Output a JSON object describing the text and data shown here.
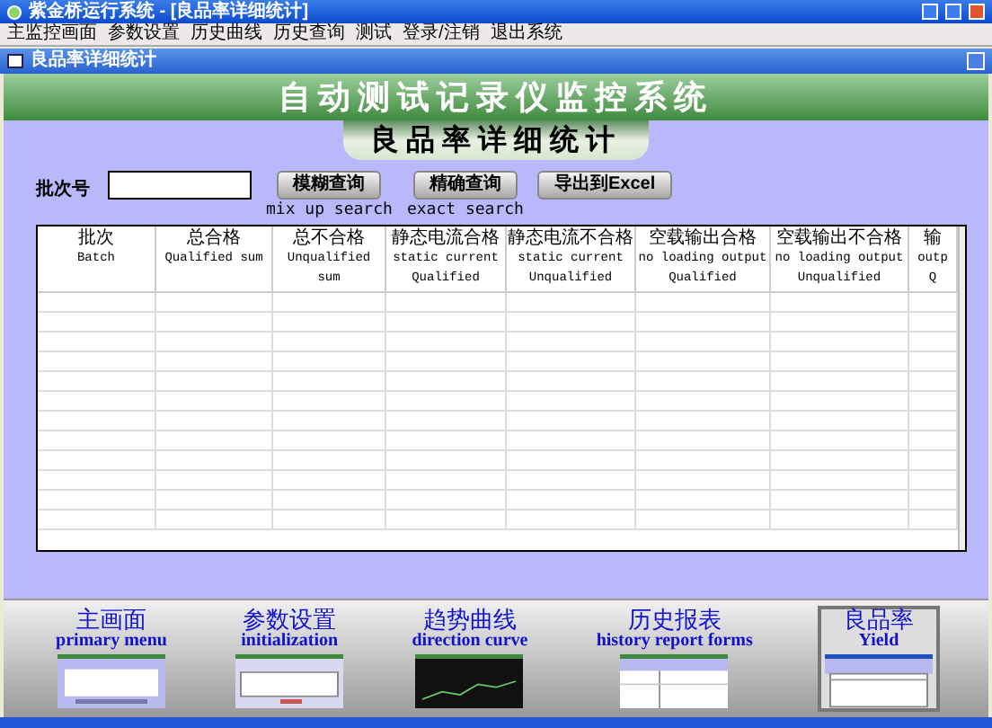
{
  "window": {
    "title": "紫金桥运行系统 - [良品率详细统计]"
  },
  "menu": [
    "主监控画面",
    "参数设置",
    "历史曲线",
    "历史查询",
    "测试",
    "登录/注销",
    "退出系统"
  ],
  "child_window": {
    "title": "良品率详细统计"
  },
  "banner": "自动测试记录仪监控系统",
  "subtitle": "良品率详细统计",
  "search": {
    "label": "批次号",
    "buttons": [
      {
        "label": "模糊查询",
        "hint": "mix up search"
      },
      {
        "label": "精确查询",
        "hint": "exact search"
      },
      {
        "label": "导出到Excel"
      }
    ]
  },
  "table": {
    "columns": [
      {
        "zh": "批次",
        "en": [
          "Batch"
        ]
      },
      {
        "zh": "总合格",
        "en": [
          "Qualified sum"
        ]
      },
      {
        "zh": "总不合格",
        "en": [
          "Unqualified",
          "sum"
        ]
      },
      {
        "zh": "静态电流合格",
        "en": [
          "static current",
          "Qualified"
        ]
      },
      {
        "zh": "静态电流不合格",
        "en": [
          "static current",
          "Unqualified"
        ]
      },
      {
        "zh": "空载输出合格",
        "en": [
          "no loading output",
          "Qualified"
        ]
      },
      {
        "zh": "空载输出不合格",
        "en": [
          "no loading output",
          "Unqualified"
        ]
      },
      {
        "zh": "输",
        "en": [
          "outp",
          "Q"
        ]
      }
    ]
  },
  "nav": [
    {
      "zh": "主画面",
      "en": "primary menu",
      "selected": false
    },
    {
      "zh": "参数设置",
      "en": "initialization",
      "selected": false
    },
    {
      "zh": "趋势曲线",
      "en": "direction curve",
      "selected": false
    },
    {
      "zh": "历史报表",
      "en": "history report forms",
      "selected": false
    },
    {
      "zh": "良品率",
      "en": "Yield",
      "selected": true
    }
  ]
}
